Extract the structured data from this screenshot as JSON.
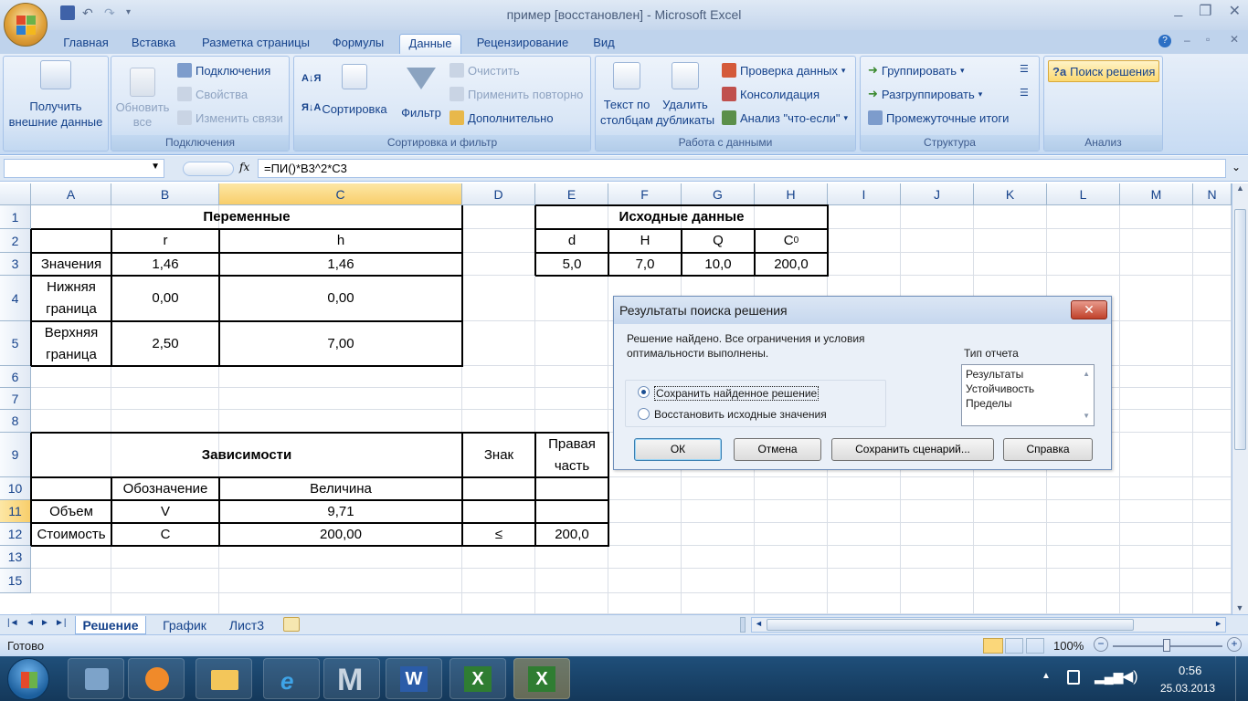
{
  "window": {
    "title": "пример [восстановлен] - Microsoft Excel"
  },
  "tabs": [
    "Главная",
    "Вставка",
    "Разметка страницы",
    "Формулы",
    "Данные",
    "Рецензирование",
    "Вид"
  ],
  "ribbon": {
    "get_external": "Получить внешние данные",
    "refresh": "Обновить все",
    "connections": "Подключения",
    "properties": "Свойства",
    "edit_links": "Изменить связи",
    "g_connections": "Подключения",
    "sort": "Сортировка",
    "filter": "Фильтр",
    "clear": "Очистить",
    "reapply": "Применить повторно",
    "advanced": "Дополнительно",
    "g_sort": "Сортировка и фильтр",
    "text_to_cols": "Текст по столбцам",
    "remove_dup": "Удалить дубликаты",
    "validation": "Проверка данных",
    "consolidation": "Консолидация",
    "whatif": "Анализ \"что-если\"",
    "g_data": "Работа с данными",
    "group": "Группировать",
    "ungroup": "Разгруппировать",
    "subtotal": "Промежуточные итоги",
    "g_outline": "Структура",
    "solver": "Поиск решения",
    "g_analysis": "Анализ"
  },
  "formula_bar": {
    "name_box": "",
    "formula": "=ПИ()*B3^2*C3"
  },
  "columns": [
    "A",
    "B",
    "C",
    "D",
    "E",
    "F",
    "G",
    "H",
    "I",
    "J",
    "K",
    "L",
    "M",
    "N"
  ],
  "rows": [
    "1",
    "2",
    "3",
    "4",
    "5",
    "6",
    "7",
    "8",
    "9",
    "10",
    "11",
    "12",
    "13",
    "15"
  ],
  "cells": {
    "vars": "Переменные",
    "r": "r",
    "h": "h",
    "values_label": "Значения",
    "b3": "1,46",
    "c3": "1,46",
    "lower_label": "Нижняя граница",
    "b4": "0,00",
    "c4": "0,00",
    "upper_label": "Верхняя граница",
    "b5": "2,50",
    "c5": "7,00",
    "source": "Исходные данные",
    "d": "d",
    "H": "H",
    "Q": "Q",
    "C0": "C",
    "e3": "5,0",
    "f3": "7,0",
    "g3": "10,0",
    "h3": "200,0",
    "deps": "Зависимости",
    "sign": "Знак",
    "rhs": "Правая часть",
    "designation": "Обозначение",
    "magnitude": "Величина",
    "volume": "Объем",
    "v": "V",
    "c11": "9,71",
    "cost": "Стоимость",
    "c": "C",
    "c12": "200,00",
    "le": "≤",
    "e12": "200,0"
  },
  "sheets": [
    "Решение",
    "График",
    "Лист3"
  ],
  "status": {
    "ready": "Готово",
    "zoom": "100%"
  },
  "dialog": {
    "title": "Результаты поиска решения",
    "message": "Решение найдено. Все ограничения и условия оптимальности выполнены.",
    "report_type": "Тип отчета",
    "reports": [
      "Результаты",
      "Устойчивость",
      "Пределы"
    ],
    "keep": "Сохранить найденное решение",
    "restore": "Восстановить исходные значения",
    "ok": "ОК",
    "cancel": "Отмена",
    "save_scenario": "Сохранить сценарий...",
    "help": "Справка"
  },
  "clock": {
    "time": "0:56",
    "date": "25.03.2013"
  }
}
